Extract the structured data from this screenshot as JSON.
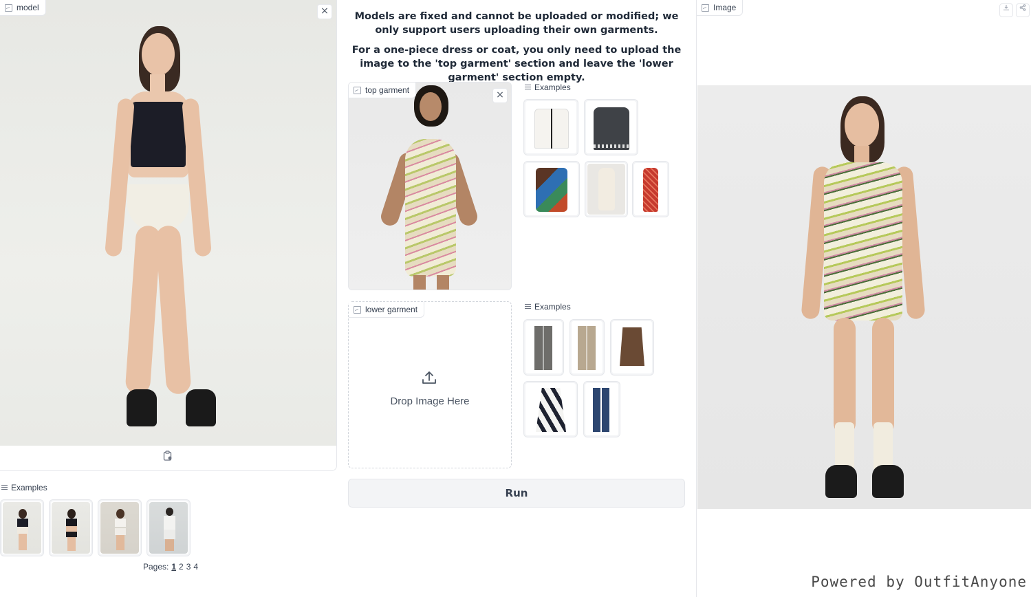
{
  "model_panel": {
    "label": "model",
    "close_icon": "×",
    "clipboard_icon": "clipboard-icon"
  },
  "model_examples": {
    "label": "Examples",
    "pages_label": "Pages:",
    "pages": [
      "1",
      "2",
      "3",
      "4"
    ],
    "current_page": "1"
  },
  "info": {
    "line1": "Models are fixed and cannot be uploaded or modified; we only support users uploading their own garments.",
    "line2": "For a one-piece dress or coat, you only need to upload the image to the 'top garment' section and leave the 'lower garment' section empty."
  },
  "top_garment": {
    "label": "top garment",
    "close_icon": "×"
  },
  "top_examples": {
    "label": "Examples"
  },
  "lower_garment": {
    "label": "lower garment",
    "drop_text": "Drop Image Here",
    "upload_icon": "upload-icon"
  },
  "lower_examples": {
    "label": "Examples"
  },
  "run_button": {
    "label": "Run"
  },
  "output": {
    "label": "Image",
    "watermark": "Powered by OutfitAnyone",
    "download_icon": "download-icon",
    "share_icon": "share-icon"
  },
  "colors": {
    "border": "#e5e7eb",
    "button_bg": "#f3f4f6",
    "text": "#374151"
  }
}
